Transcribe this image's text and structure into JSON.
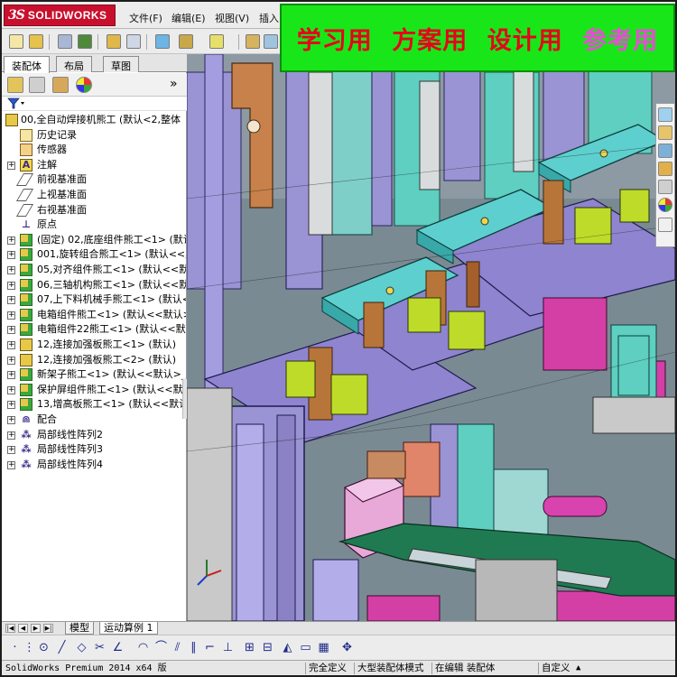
{
  "app": {
    "logo_mark": "3S",
    "logo_text": "SOLIDWORKS"
  },
  "menu": {
    "items": [
      "文件(F)",
      "编辑(E)",
      "视图(V)",
      "插入"
    ]
  },
  "banner": {
    "words": [
      {
        "text": "学习用",
        "color": "#e8001c"
      },
      {
        "text": "方案用",
        "color": "#e8001c"
      },
      {
        "text": "设计用",
        "color": "#e8001c"
      },
      {
        "text": "参考用",
        "color": "#e84bd6"
      }
    ]
  },
  "panel": {
    "tabs": [
      "装配体",
      "布局",
      "草图"
    ],
    "active_tab": "装配体",
    "collapse_glyph": "»"
  },
  "tree": {
    "nodes": [
      {
        "label": "00,全自动焊接机熊工 (默认<2,整体",
        "icon": "assembly-icon",
        "expander": "",
        "indent": 0
      },
      {
        "label": "历史记录",
        "icon": "history-icon",
        "expander": "",
        "indent": 1
      },
      {
        "label": "传感器",
        "icon": "sensor-icon",
        "expander": "",
        "indent": 1
      },
      {
        "label": "注解",
        "icon": "annotation-icon",
        "expander": "+",
        "indent": 1
      },
      {
        "label": "前视基准面",
        "icon": "plane-icon",
        "expander": "",
        "indent": 1
      },
      {
        "label": "上视基准面",
        "icon": "plane-icon",
        "expander": "",
        "indent": 1
      },
      {
        "label": "右视基准面",
        "icon": "plane-icon",
        "expander": "",
        "indent": 1
      },
      {
        "label": "原点",
        "icon": "origin-icon",
        "expander": "",
        "indent": 1
      },
      {
        "label": "(固定) 02,底座组件熊工<1> (默认<<",
        "icon": "subassembly-icon",
        "expander": "+",
        "indent": 1
      },
      {
        "label": "001,旋转组合熊工<1> (默认<<默",
        "icon": "subassembly-icon",
        "expander": "+",
        "indent": 1
      },
      {
        "label": "05,对齐组件熊工<1> (默认<<默认",
        "icon": "subassembly-icon",
        "expander": "+",
        "indent": 1
      },
      {
        "label": "06,三轴机构熊工<1> (默认<<默认",
        "icon": "subassembly-icon",
        "expander": "+",
        "indent": 1
      },
      {
        "label": "07,上下料机械手熊工<1> (默认<<",
        "icon": "subassembly-icon",
        "expander": "+",
        "indent": 1
      },
      {
        "label": "电箱组件熊工<1> (默认<<默认>",
        "icon": "subassembly-icon",
        "expander": "+",
        "indent": 1
      },
      {
        "label": "电箱组件22熊工<1> (默认<<默认",
        "icon": "subassembly-icon",
        "expander": "+",
        "indent": 1
      },
      {
        "label": "12,连接加强板熊工<1> (默认)",
        "icon": "part-icon",
        "expander": "+",
        "indent": 1
      },
      {
        "label": "12,连接加强板熊工<2> (默认)",
        "icon": "part-icon",
        "expander": "+",
        "indent": 1
      },
      {
        "label": "新架子熊工<1> (默认<<默认>_外",
        "icon": "subassembly-icon",
        "expander": "+",
        "indent": 1
      },
      {
        "label": "保护屏组件熊工<1> (默认<<默认",
        "icon": "subassembly-icon",
        "expander": "+",
        "indent": 1
      },
      {
        "label": "13,增高板熊工<1> (默认<<默认",
        "icon": "subassembly-icon",
        "expander": "+",
        "indent": 1
      },
      {
        "label": "配合",
        "icon": "mates-icon",
        "expander": "+",
        "indent": 1
      },
      {
        "label": "局部线性阵列2",
        "icon": "pattern-icon",
        "expander": "+",
        "indent": 1
      },
      {
        "label": "局部线性阵列3",
        "icon": "pattern-icon",
        "expander": "+",
        "indent": 1
      },
      {
        "label": "局部线性阵列4",
        "icon": "pattern-icon",
        "expander": "+",
        "indent": 1
      }
    ]
  },
  "bottom_tabs": [
    "模型",
    "运动算例 1"
  ],
  "statusbar": {
    "version": "SolidWorks Premium 2014 x64 版",
    "fully_defined": "完全定义",
    "large_assembly": "大型装配体模式",
    "editing": "在编辑 装配体",
    "custom": "自定义"
  },
  "colors": {
    "plate_cyan": "#5ecfcf",
    "frame_purple": "#8f84cf",
    "block_lime": "#bedb29",
    "part_magenta": "#d43fa6",
    "bracket_orange": "#c8814a",
    "spring_brown": "#b8753a",
    "pink_box": "#e8a8d8",
    "dark_green": "#1f7a52"
  }
}
